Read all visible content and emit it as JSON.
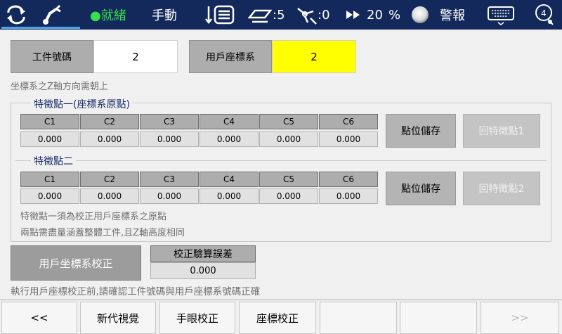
{
  "topbar": {
    "mode_status": "●就緒",
    "mode_manual": "手動",
    "tool_value": ":5",
    "joint_value": ":0",
    "speed_value": "20",
    "speed_unit": "%",
    "alarm_label": "警報",
    "circle_badge": "4",
    "colors": {
      "background": "#13295c",
      "ready": "#35e04a"
    }
  },
  "header": {
    "workpiece_label": "工件號碼",
    "workpiece_value": "2",
    "user_frame_label": "用戶座標系",
    "user_frame_value": "2",
    "note": "坐標系之Z軸方向需朝上",
    "colors": {
      "user_frame_value_bg": "#ffff00"
    }
  },
  "point1": {
    "title": "特徵點一(座標系原點)",
    "columns": [
      "C1",
      "C2",
      "C3",
      "C4",
      "C5",
      "C6"
    ],
    "values": [
      "0.000",
      "0.000",
      "0.000",
      "0.000",
      "0.000",
      "0.000"
    ],
    "save_button": "點位儲存",
    "return_button": "回特徵點1"
  },
  "point2": {
    "title": "特徵點二",
    "columns": [
      "C1",
      "C2",
      "C3",
      "C4",
      "C5",
      "C6"
    ],
    "values": [
      "0.000",
      "0.000",
      "0.000",
      "0.000",
      "0.000",
      "0.000"
    ],
    "save_button": "點位儲存",
    "return_button": "回特徵點2"
  },
  "notes": {
    "line1": "特徵點一須為校正用戶座標系之原點",
    "line2": "兩點需盡量涵蓋整體工件,且Z軸高度相同"
  },
  "calibration": {
    "button": "用戶坐標系校正",
    "error_label": "校正驗算誤差",
    "error_value": "0.000",
    "footer_note": "執行用戶座標校正前,請確認工件號碼與用戶座標系號碼正確"
  },
  "bottom_nav": {
    "prev": "<<",
    "tab1": "新代視覺",
    "tab2": "手眼校正",
    "tab3": "座標校正",
    "tab4": "",
    "tab5": "",
    "next": ">>"
  }
}
